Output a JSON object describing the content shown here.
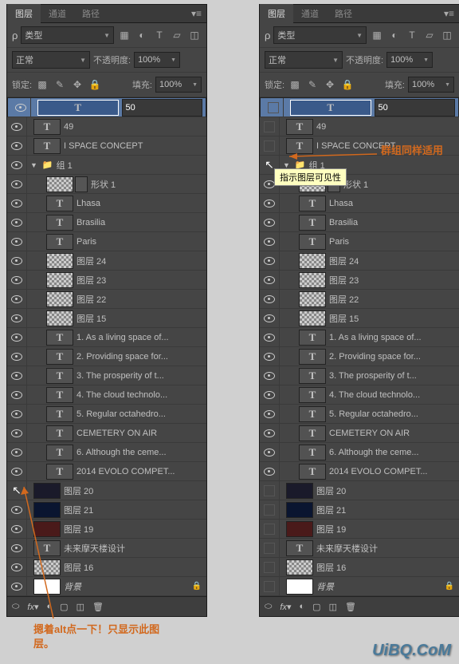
{
  "tabs": {
    "layers": "图层",
    "channels": "通道",
    "paths": "路径"
  },
  "filter": {
    "label": "类型"
  },
  "blend": {
    "mode": "正常",
    "opacity_label": "不透明度:",
    "opacity": "100%",
    "opacity_dim": "100%"
  },
  "lock": {
    "label": "锁定:",
    "fill_label": "填充:",
    "fill": "100%",
    "fill_dim": "100%"
  },
  "layers_data": [
    {
      "name": "50",
      "type": "text",
      "sel": true
    },
    {
      "name": "49",
      "type": "text"
    },
    {
      "name": "I  SPACE CONCEPT",
      "type": "text"
    },
    {
      "name": "组 1",
      "type": "group"
    },
    {
      "name": "形状 1",
      "type": "shape",
      "indent": 1,
      "mask": true
    },
    {
      "name": "Lhasa",
      "type": "text",
      "indent": 1
    },
    {
      "name": "Brasilia",
      "type": "text",
      "indent": 1
    },
    {
      "name": "Paris",
      "type": "text",
      "indent": 1
    },
    {
      "name": "图层 24",
      "type": "bitmap",
      "indent": 1
    },
    {
      "name": "图层 23",
      "type": "bitmap",
      "indent": 1
    },
    {
      "name": "图层 22",
      "type": "bitmap",
      "indent": 1
    },
    {
      "name": "图层 15",
      "type": "bitmap",
      "indent": 1
    },
    {
      "name": "1. As a living space of...",
      "type": "text",
      "indent": 1
    },
    {
      "name": "2. Providing space for...",
      "type": "text",
      "indent": 1
    },
    {
      "name": "3. The prosperity of t...",
      "type": "text",
      "indent": 1
    },
    {
      "name": "4. The cloud technolo...",
      "type": "text",
      "indent": 1
    },
    {
      "name": "5. Regular octahedro...",
      "type": "text",
      "indent": 1
    },
    {
      "name": "CEMETERY ON AIR",
      "type": "text",
      "indent": 1
    },
    {
      "name": "6. Although the ceme...",
      "type": "text",
      "indent": 1
    },
    {
      "name": "2014 EVOLO COMPET...",
      "type": "text",
      "indent": 1
    },
    {
      "name": "图层 20",
      "type": "dark"
    },
    {
      "name": "图层 21",
      "type": "darkblue"
    },
    {
      "name": "图层 19",
      "type": "red"
    },
    {
      "name": "未来摩天楼设计",
      "type": "text"
    },
    {
      "name": "图层 16",
      "type": "bitmap"
    },
    {
      "name": "背景",
      "type": "bg",
      "italic": true,
      "locked": true
    }
  ],
  "anno": {
    "left": "摁着alt点一下！只显示此图层。",
    "right": "群组同样适用",
    "tooltip": "指示图层可见性"
  },
  "watermark": "UiBQ.CoM"
}
